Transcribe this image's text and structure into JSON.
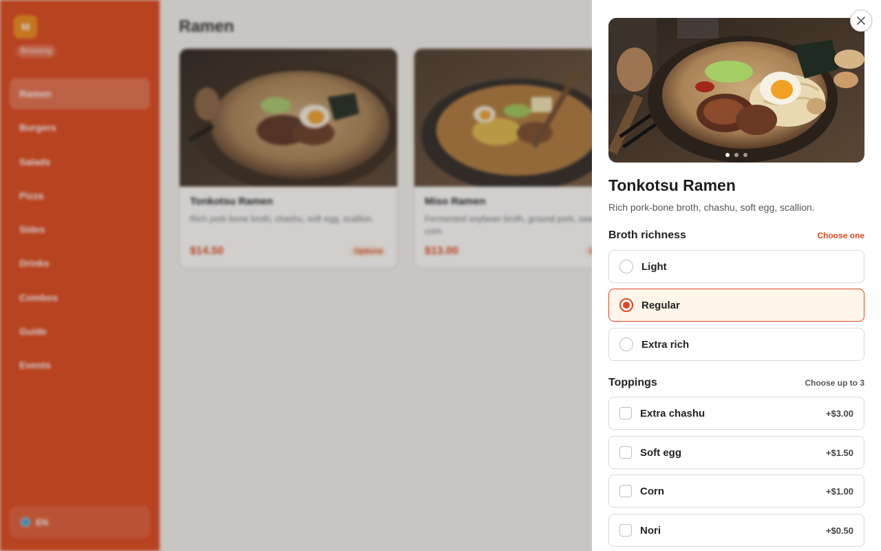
{
  "sidebar": {
    "logo_letter": "M",
    "status": "Browsing",
    "items": [
      {
        "label": "Ramen",
        "active": true
      },
      {
        "label": "Burgers"
      },
      {
        "label": "Salads"
      },
      {
        "label": "Pizza"
      },
      {
        "label": "Sides"
      },
      {
        "label": "Drinks"
      },
      {
        "label": "Combos"
      },
      {
        "label": "Guide"
      },
      {
        "label": "Events"
      }
    ],
    "language": "EN"
  },
  "main": {
    "title": "Ramen",
    "cards": [
      {
        "title": "Tonkotsu Ramen",
        "desc": "Rich pork-bone broth, chashu, soft egg, scallion.",
        "price": "$14.50",
        "badge": "Options"
      },
      {
        "title": "Miso Ramen",
        "desc": "Fermented soybean broth, ground pork, sweet corn.",
        "price": "$13.00",
        "badge": "Options"
      }
    ]
  },
  "drawer": {
    "item_title": "Tonkotsu Ramen",
    "item_desc": "Rich pork-bone broth, chashu, soft egg, scallion.",
    "carousel": {
      "count": 3,
      "active_index": 0
    },
    "broth": {
      "title": "Broth richness",
      "rule": "Choose one",
      "options": [
        {
          "label": "Light",
          "selected": false
        },
        {
          "label": "Regular",
          "selected": true
        },
        {
          "label": "Extra rich",
          "selected": false
        }
      ]
    },
    "toppings": {
      "title": "Toppings",
      "rule": "Choose up to 3",
      "options": [
        {
          "label": "Extra chashu",
          "price": "+$3.00"
        },
        {
          "label": "Soft egg",
          "price": "+$1.50"
        },
        {
          "label": "Corn",
          "price": "+$1.00"
        },
        {
          "label": "Nori",
          "price": "+$0.50"
        }
      ]
    }
  },
  "colors": {
    "accent": "#e0471c",
    "selected_bg": "#fff5ea",
    "sidebar": "#e0471c"
  },
  "icons": {
    "close": "close-icon",
    "language": "globe-icon"
  }
}
